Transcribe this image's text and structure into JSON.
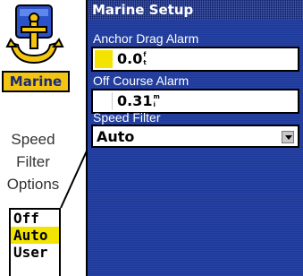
{
  "callout": {
    "app_icon": "marine-anchor-icon",
    "app_label": "Marine",
    "caption_lines": [
      "Speed",
      "Filter",
      "Options"
    ],
    "options": [
      {
        "label": "Off",
        "selected": false
      },
      {
        "label": "Auto",
        "selected": true
      },
      {
        "label": "User",
        "selected": false
      }
    ]
  },
  "screen": {
    "title": "Marine Setup",
    "anchor_drag_alarm": {
      "label": "Anchor Drag Alarm",
      "value": "0.0",
      "unit_top": "f",
      "unit_bottom": "t",
      "swatch_color": "#f2e400"
    },
    "off_course_alarm": {
      "label": "Off Course Alarm",
      "value": "0.31",
      "unit_top": "m",
      "unit_bottom": "i",
      "swatch_color": "#ffffff"
    },
    "speed_filter": {
      "label": "Speed Filter",
      "value": "Auto",
      "control_icon": "chevron-down-icon"
    }
  },
  "colors": {
    "screen_bg": "#1e3a9c",
    "title_bg": "#0d1f6a",
    "highlight": "#f2e400",
    "marine_badge": "#f3c411"
  }
}
